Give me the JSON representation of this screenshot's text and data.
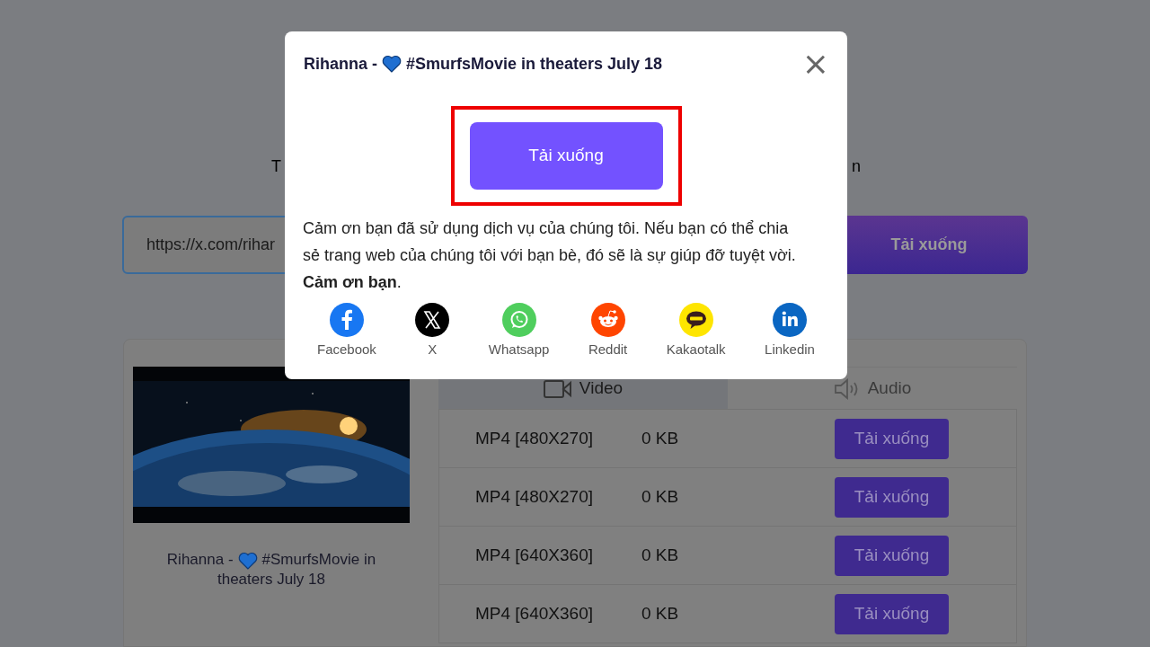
{
  "page": {
    "heading_start": "T",
    "heading_end": "n",
    "url_field": {
      "value": "https://x.com/rihar"
    },
    "download_button": "Tải xuống"
  },
  "result": {
    "title_parts": [
      "Rihanna -",
      "#SmurfsMovie in theaters July 18"
    ],
    "tabs": [
      {
        "label": "Video",
        "kind": "video",
        "selected": true
      },
      {
        "label": "Audio",
        "kind": "audio",
        "selected": false
      }
    ],
    "rows": [
      {
        "format": "MP4 [480X270]",
        "size": "0 KB",
        "button": "Tải xuống"
      },
      {
        "format": "MP4 [480X270]",
        "size": "0 KB",
        "button": "Tải xuống"
      },
      {
        "format": "MP4 [640X360]",
        "size": "0 KB",
        "button": "Tải xuống"
      },
      {
        "format": "MP4 [640X360]",
        "size": "0 KB",
        "button": "Tải xuống"
      }
    ]
  },
  "modal": {
    "title_parts": [
      "Rihanna -",
      "#SmurfsMovie in theaters July 18"
    ],
    "close": "×",
    "download_button": "Tải xuống",
    "highlighted": true,
    "message": "Cảm ơn bạn đã sử dụng dịch vụ của chúng tôi. Nếu bạn có thể chia sẻ trang web của chúng tôi với bạn bè, đó sẽ là sự giúp đỡ tuyệt vời. **Cảm ơn bạn**.",
    "share": [
      {
        "label": "Facebook",
        "kind": "facebook",
        "color": "#1877f2"
      },
      {
        "label": "X",
        "kind": "x",
        "color": "#000000"
      },
      {
        "label": "Whatsapp",
        "kind": "whatsapp",
        "color": "#4fce5d"
      },
      {
        "label": "Reddit",
        "kind": "reddit",
        "color": "#ff4500"
      },
      {
        "label": "Kakaotalk",
        "kind": "kakaotalk",
        "color": "#fee500"
      },
      {
        "label": "Linkedin",
        "kind": "linkedin",
        "color": "#0a66c2"
      }
    ]
  }
}
